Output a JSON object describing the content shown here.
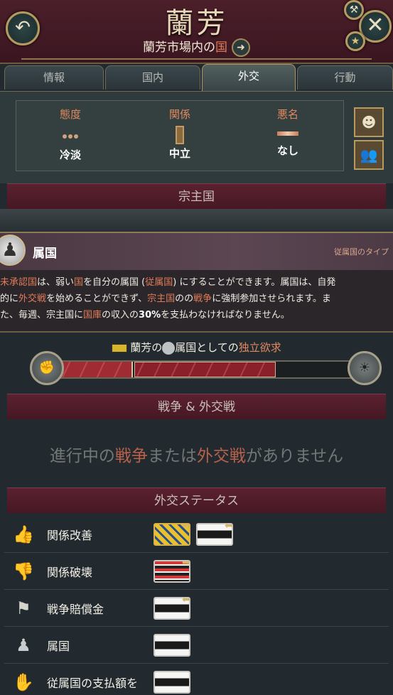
{
  "header": {
    "title": "蘭芳",
    "subtitle_prefix": "蘭芳市場内の",
    "subtitle_accent": "国",
    "back_icon": "back-arrow-icon",
    "close_icon": "close-x-icon"
  },
  "tabs": [
    {
      "label": "情報"
    },
    {
      "label": "国内"
    },
    {
      "label": "外交"
    },
    {
      "label": "行動"
    }
  ],
  "relations": {
    "attitude": {
      "label": "態度",
      "value": "冷淡"
    },
    "relation": {
      "label": "関係",
      "value": "中立"
    },
    "infamy": {
      "label": "悪名",
      "value": "なし"
    }
  },
  "overlord_section": {
    "label": "宗主国"
  },
  "tooltip": {
    "title": "属国",
    "type_label": "従属国のタイプ",
    "line1_a": "未承認国",
    "line1_b": "は、弱い",
    "line1_c": "国",
    "line1_d": "を自分の属国 (",
    "line1_e": "従属国",
    "line1_f": ") にすることができます。属国は、自発",
    "line2_a": "的に",
    "line2_b": "外交戦",
    "line2_c": "を始めることができず、",
    "line2_d": "宗主国",
    "line2_e": "の",
    "line2_f": "の",
    "line2_g": "戦争",
    "line2_h": "に強制参加させられます。ま",
    "line3_a": "た、毎週、宗主国に",
    "line3_b": "国庫",
    "line3_c": "の収入の",
    "line3_d": "30%",
    "line3_e": "を支払わなければなりません。"
  },
  "independence": {
    "country": "蘭芳",
    "part_a": "の",
    "part_b": "属国",
    "part_c": "としての",
    "part_d": "独立欲求",
    "progress_left": 0.29,
    "progress_mid": 0.46
  },
  "war_section": {
    "label": "戦争 & 外交戦",
    "empty_a": "進行中の",
    "empty_b": "戦争",
    "empty_c": "または",
    "empty_d": "外交戦",
    "empty_e": "がありません"
  },
  "diplo_status": {
    "label": "外交ステータス",
    "rows": [
      {
        "label": "関係改善",
        "icon": "thumbs-up-icon"
      },
      {
        "label": "関係破壊",
        "icon": "thumbs-down-icon"
      },
      {
        "label": "戦争賠償金",
        "icon": "flag-ship-icon"
      },
      {
        "label": "属国",
        "icon": "pawn-icon"
      },
      {
        "label": "従属国の支払額を",
        "icon": "hand-icon"
      }
    ]
  },
  "colors": {
    "accent": "#e07b57",
    "header": "#4b1f2a",
    "section": "#5b2130"
  }
}
